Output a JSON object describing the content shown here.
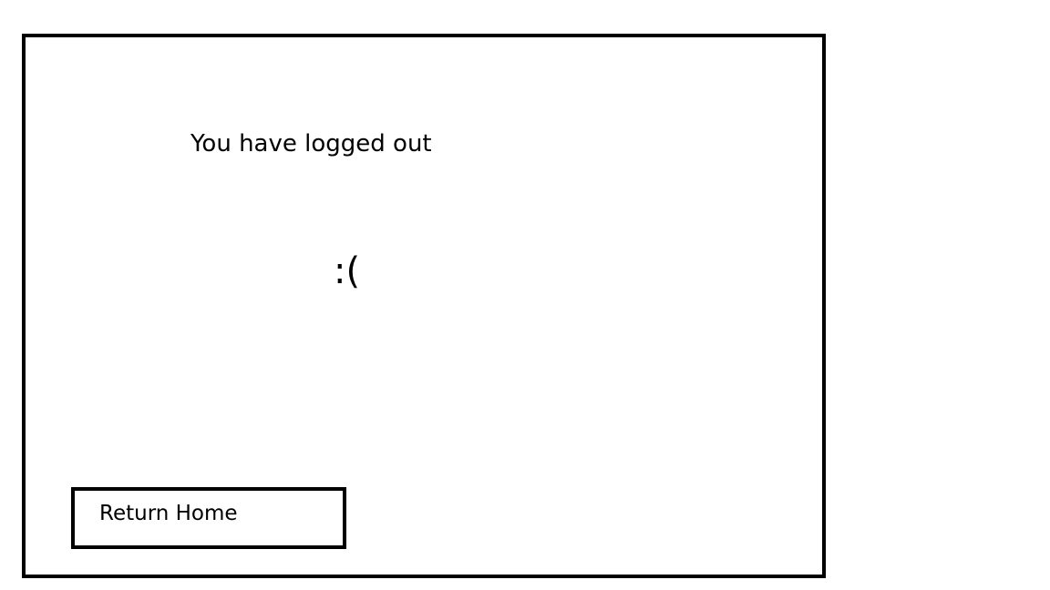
{
  "logout": {
    "message": "You have logged out",
    "emoticon": ":(",
    "button_label": "Return Home"
  },
  "colors": {
    "border": "#000000",
    "background": "#ffffff",
    "text": "#000000"
  }
}
